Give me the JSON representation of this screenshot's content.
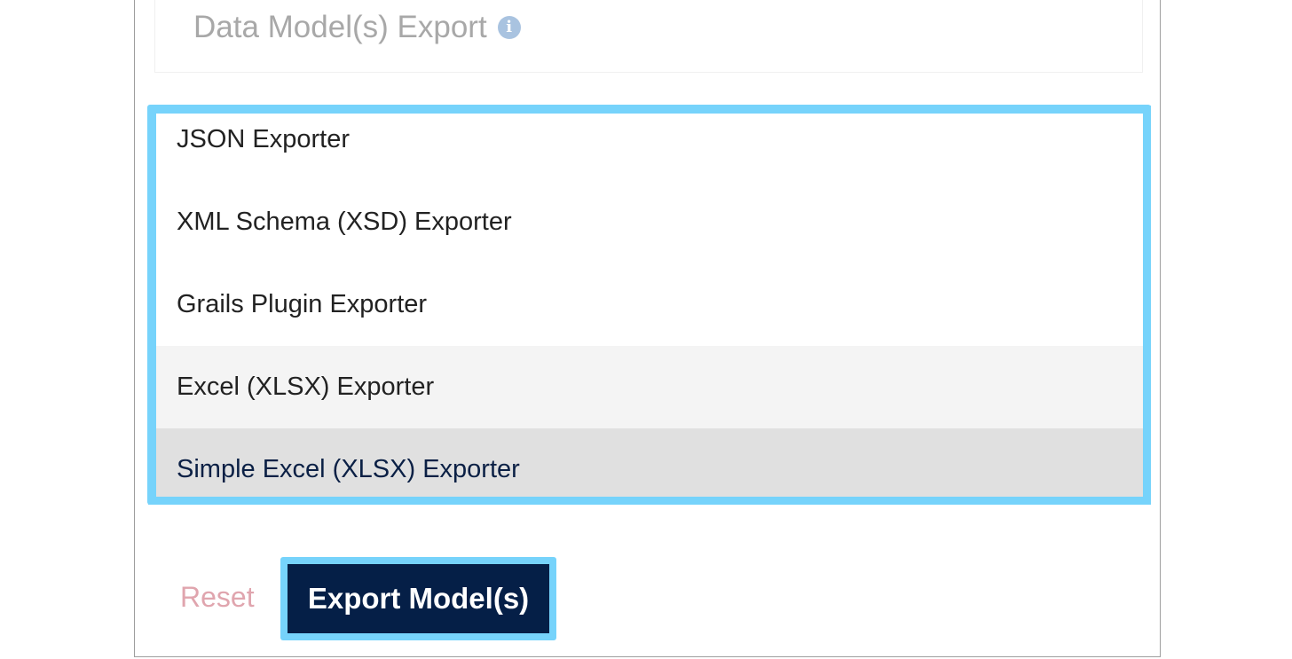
{
  "header": {
    "title": "Data Model(s) Export",
    "info_icon": "info-icon",
    "info_glyph": "i"
  },
  "exporters": {
    "options": [
      {
        "label": "JSON Exporter",
        "state": "normal"
      },
      {
        "label": "XML Schema (XSD) Exporter",
        "state": "normal"
      },
      {
        "label": "Grails Plugin Exporter",
        "state": "normal"
      },
      {
        "label": "Excel (XLSX) Exporter",
        "state": "hover"
      },
      {
        "label": "Simple Excel (XLSX) Exporter",
        "state": "selected"
      }
    ],
    "selected_value": "Simple Excel (XLSX) Exporter"
  },
  "actions": {
    "reset_label": "Reset",
    "export_label": "Export Model(s)"
  },
  "colors": {
    "focus_ring": "#76d3fb",
    "primary_button": "#051f47",
    "reset_text": "#e0a5ae",
    "selected_option_bg": "#e0e0e0",
    "hover_option_bg": "#f4f4f4",
    "info_icon": "#a9c3e0"
  }
}
